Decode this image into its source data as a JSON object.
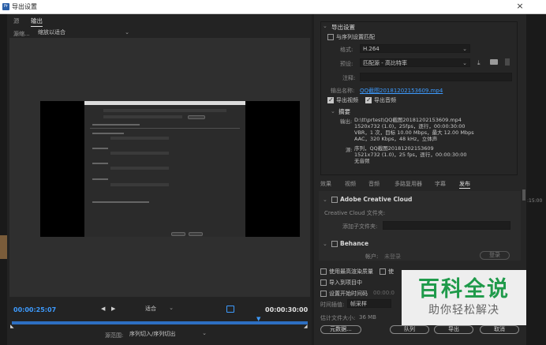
{
  "window": {
    "title": "导出设置",
    "close": "×"
  },
  "left": {
    "tabs": [
      "源",
      "输出"
    ],
    "scale_label": "源缩...",
    "scale_value": "缩放以适合",
    "timecode_current": "00:00:25:07",
    "timecode_end": "00:00:30:00",
    "fit_value": "适合",
    "range_label": "源范围:",
    "range_value": "序列切入/序列切出"
  },
  "export_settings": {
    "header": "导出设置",
    "match_sequence": "与序列设置匹配",
    "format_label": "格式:",
    "format_value": "H.264",
    "preset_label": "预设:",
    "preset_value": "匹配源 - 高比特率",
    "comment_label": "注释:",
    "output_name_label": "输出名称:",
    "output_name_value": "QQ截图20181202153609.mp4",
    "export_video": "导出视频",
    "export_audio": "导出音频"
  },
  "summary": {
    "header": "摘要",
    "output_label": "输出:",
    "output_lines": [
      "D:\\tt\\prtest\\QQ截图20181202153609.mp4",
      "1520x732 (1.0)，25fps，逐行，00:00:30:00",
      "VBR，1 次，目标 10.00 Mbps，最大 12.00 Mbps",
      "AAC，320 Kbps，48 kHz，立体声"
    ],
    "source_label": "源:",
    "source_lines": [
      "序列，QQ截图20181202153609",
      "1521x732 (1.0)，25 fps，逐行，00:00:30:00",
      "无音频"
    ]
  },
  "feature_tabs": [
    "效果",
    "视频",
    "音频",
    "多路复用器",
    "字幕",
    "发布"
  ],
  "publish": {
    "creative_cloud": "Adobe Creative Cloud",
    "cc_folder_label": "Creative Cloud 文件夹:",
    "add_subfolder_label": "添加子文件夹:",
    "behance": "Behance",
    "account_label": "帐户:",
    "account_value": "未登录",
    "login_btn": "登录"
  },
  "options": {
    "max_render_quality": "使用最高渲染质量",
    "preview_prefix": "使",
    "import_into_project": "导入到项目中",
    "set_start_timecode": "设置开始时间码",
    "start_timecode_value": "00:00:0",
    "interpolation_label": "时间插值:",
    "interpolation_value": "帧采样",
    "file_size_label": "估计文件大小:",
    "file_size_value": "36 MB"
  },
  "buttons": {
    "metadata": "元数据...",
    "queue": "队列",
    "export": "导出",
    "cancel": "取消"
  },
  "watermark": {
    "title": "百科全说",
    "subtitle": "助你轻松解决"
  },
  "background": {
    "timeline_time": ":15:00"
  }
}
